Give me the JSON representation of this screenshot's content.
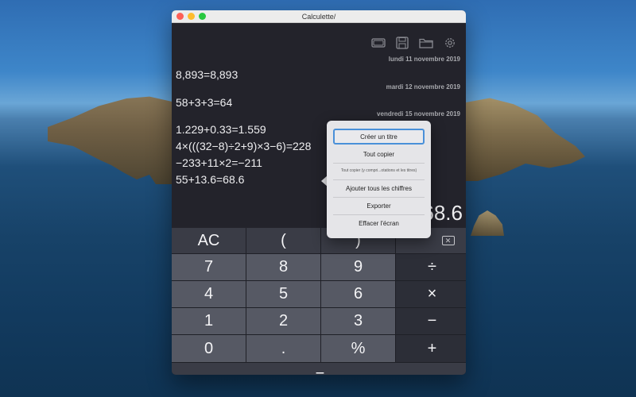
{
  "window": {
    "title": "Calculette/"
  },
  "toolbar": {
    "icons": [
      "screen-icon",
      "save-icon",
      "folder-icon",
      "gear-icon"
    ]
  },
  "history": {
    "entries": [
      {
        "date": "lundi 11 novembre 2019",
        "lines": [
          "8,893=8,893"
        ]
      },
      {
        "date": "mardi 12 novembre 2019",
        "lines": [
          "58+3+3=64"
        ]
      },
      {
        "date": "vendredi 15 novembre 2019",
        "lines": [
          "1.229+0.33=1.559",
          "4×(((32−8)÷2+9)×3−6)=228",
          "−233+11×2=−211",
          "55+13.6=68.6"
        ]
      }
    ],
    "display": "68.6"
  },
  "keypad": {
    "row1": [
      "AC",
      "(",
      ")",
      "⌫"
    ],
    "row2": [
      "7",
      "8",
      "9",
      "÷"
    ],
    "row3": [
      "4",
      "5",
      "6",
      "×"
    ],
    "row4": [
      "1",
      "2",
      "3",
      "−"
    ],
    "row5": [
      "0",
      ".",
      "%",
      "+"
    ],
    "equals": "="
  },
  "context_menu": {
    "items": [
      "Créer un titre",
      "Tout copier",
      "Tout copier (y compri...otations et les titres)",
      "Ajouter tous les chiffres",
      "Exporter",
      "Effacer l'écran"
    ],
    "selected_index": 0
  },
  "colors": {
    "accent": "#4a90d9",
    "window_bg": "#2b2b31",
    "key_bg": "#565964"
  }
}
